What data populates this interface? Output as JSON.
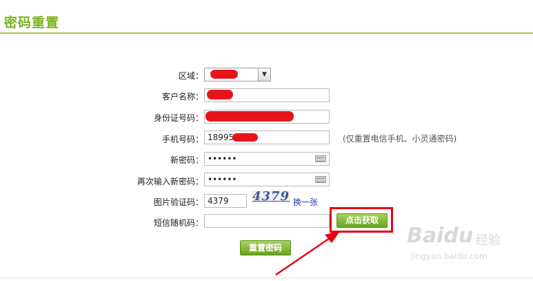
{
  "page": {
    "title": "密码重置"
  },
  "form": {
    "region": {
      "label": "区域：",
      "value": ""
    },
    "customer_name": {
      "label": "客户名称：",
      "value": ""
    },
    "id_number": {
      "label": "身份证号码：",
      "value": ""
    },
    "phone": {
      "label": "手机号码：",
      "value": "18995",
      "hint": "(仅重置电信手机、小灵通密码)"
    },
    "new_password": {
      "label": "新密码：",
      "value": "••••••"
    },
    "confirm_password": {
      "label": "再次输入新密码：",
      "value": "••••••"
    },
    "captcha": {
      "label": "图片验证码：",
      "value": "4379",
      "image_text": "4379",
      "refresh_link": "换一张"
    },
    "sms_code": {
      "label": "短信随机码：",
      "value": "",
      "get_button": "点击获取"
    },
    "submit_label": "重置密码"
  },
  "watermark": {
    "brand": "Baidu",
    "cn": "经验",
    "site": "jingyan.baidu.com"
  },
  "colors": {
    "accent": "#7bb31f",
    "button": "#6aa31f",
    "highlight": "#e60012",
    "redact": "#e8141b"
  }
}
